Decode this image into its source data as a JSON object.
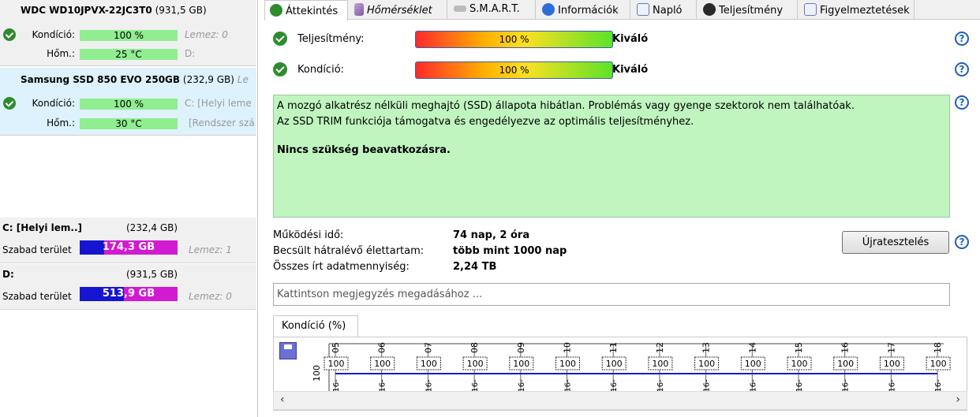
{
  "drives": [
    {
      "model": "WDC WD10JPVX-22JC3T0",
      "size": "(931,5 GB)",
      "health_label": "Kondíció:",
      "health_value": "100 %",
      "health_aux": "Lemez: 0",
      "temp_label": "Hőm.:",
      "temp_value": "25 °C",
      "temp_aux": "D:"
    },
    {
      "model": "Samsung SSD 850 EVO 250GB",
      "size": "(232,9 GB)",
      "size_suffix": "Le",
      "health_label": "Kondíció:",
      "health_value": "100 %",
      "health_aux": "C: [Helyi leme",
      "temp_label": "Hőm.:",
      "temp_value": "30 °C",
      "temp_aux": "[Rendszer szá"
    }
  ],
  "volumes": [
    {
      "name": "C: [Helyi lem..]",
      "size": "(232,4 GB)",
      "free_label": "Szabad terület",
      "free_value": "174,3 GB",
      "disk": "Lemez: 1",
      "free_fraction": 0.75
    },
    {
      "name": "D:",
      "size": "(931,5 GB)",
      "free_label": "Szabad terület",
      "free_value": "513,9 GB",
      "disk": "Lemez: 0",
      "free_fraction": 0.55
    }
  ],
  "tabs": [
    {
      "label": "Áttekintés",
      "icon": "check-icon",
      "active": true
    },
    {
      "label": "Hőmérséklet",
      "icon": "thermometer-icon"
    },
    {
      "label": "S.M.A.R.T.",
      "icon": "smart-icon"
    },
    {
      "label": "Információk",
      "icon": "info-icon"
    },
    {
      "label": "Napló",
      "icon": "log-icon"
    },
    {
      "label": "Teljesítmény",
      "icon": "gauge-icon"
    },
    {
      "label": "Figyelmeztetések",
      "icon": "alerts-icon"
    }
  ],
  "overview": {
    "performance_label": "Teljesítmény:",
    "performance_value": "100 %",
    "performance_rating": "Kiváló",
    "health_label": "Kondíció:",
    "health_value": "100 %",
    "health_rating": "Kiváló",
    "description_line1": "A mozgó alkatrész nélküli meghajtó (SSD) állapota hibátlan. Problémás vagy gyenge szektorok nem találhatóak.",
    "description_line2": "Az SSD TRIM funkciója támogatva és engedélyezve az optimális teljesítményhez.",
    "description_bold": "Nincs szükség beavatkozásra.",
    "uptime_label": "Működési idő:",
    "uptime_value": "74 nap, 2 óra",
    "lifetime_label": "Becsült hátralévő élettartam:",
    "lifetime_value": "több mint 1000 nap",
    "written_label": "Összes írt adatmennyiség:",
    "written_value": "2,24 TB",
    "retest_button": "Újratesztelés",
    "note_placeholder": "Kattintson megjegyzés megadásához ...",
    "help_glyph": "?"
  },
  "chart_tab": "Kondíció  (%)",
  "chart_data": {
    "type": "line",
    "y_tick": "100",
    "x": [
      "05",
      "06",
      "07",
      "08",
      "09",
      "10",
      "11",
      "12",
      "13",
      "14",
      "15",
      "16",
      "17",
      "18"
    ],
    "x_prefix": "016-",
    "series": [
      {
        "values": [
          100,
          100,
          100,
          100,
          100,
          100,
          100,
          100,
          100,
          100,
          100,
          100,
          100,
          100
        ]
      }
    ],
    "line_color": "#1c1cc8"
  }
}
